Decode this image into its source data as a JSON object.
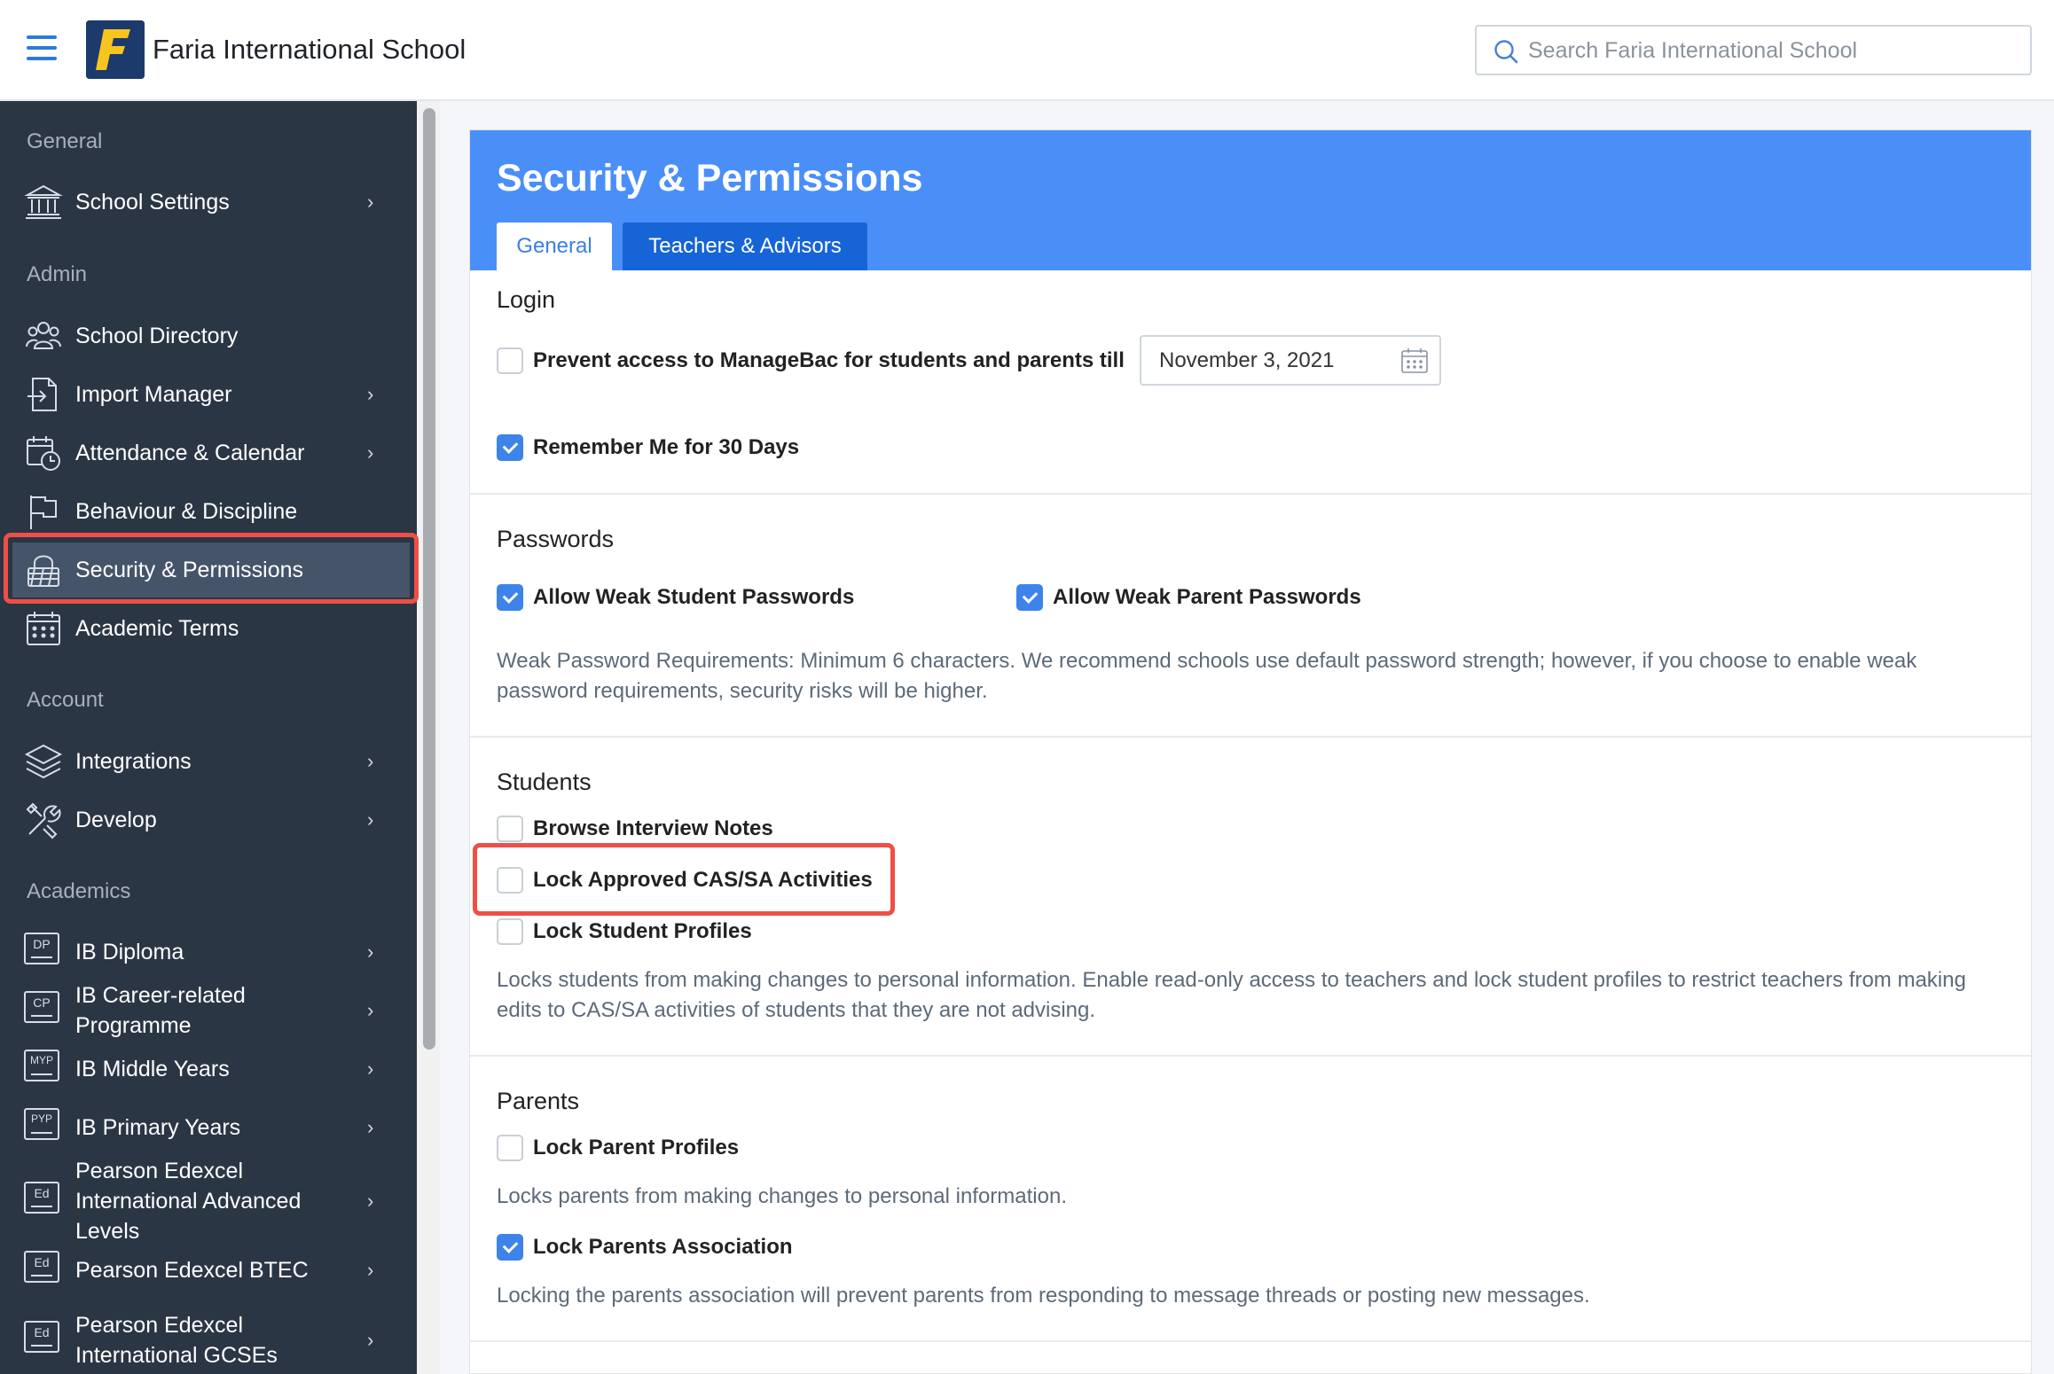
{
  "header": {
    "school_name": "Faria International School",
    "search_placeholder": "Search Faria International School"
  },
  "sidebar": {
    "sections": {
      "general": "General",
      "admin": "Admin",
      "account": "Account",
      "academics": "Academics"
    },
    "items": [
      {
        "label": "School Settings",
        "icon": "bank-icon"
      },
      {
        "label": "School Directory",
        "icon": "users-icon"
      },
      {
        "label": "Import Manager",
        "icon": "import-icon"
      },
      {
        "label": "Attendance & Calendar",
        "icon": "calendar-clock-icon"
      },
      {
        "label": "Behaviour & Discipline",
        "icon": "flag-icon"
      },
      {
        "label": "Security & Permissions",
        "icon": "lock-icon"
      },
      {
        "label": "Academic Terms",
        "icon": "calendar-icon"
      },
      {
        "label": "Integrations",
        "icon": "layers-icon"
      },
      {
        "label": "Develop",
        "icon": "tools-icon"
      },
      {
        "label": "IB Diploma",
        "icon": "dp-badge-icon",
        "badge": "DP"
      },
      {
        "label": "IB Career-related Programme",
        "icon": "cp-badge-icon",
        "badge": "CP"
      },
      {
        "label": "IB Middle Years",
        "icon": "myp-badge-icon",
        "badge": "MYP"
      },
      {
        "label": "IB Primary Years",
        "icon": "pyp-badge-icon",
        "badge": "PYP"
      },
      {
        "label": "Pearson Edexcel International Advanced Levels",
        "icon": "ed-badge-icon",
        "badge": "Ed"
      },
      {
        "label": "Pearson Edexcel BTEC",
        "icon": "ed-badge-icon",
        "badge": "Ed"
      },
      {
        "label": "Pearson Edexcel International GCSEs",
        "icon": "ed-badge-icon",
        "badge": "Ed"
      }
    ],
    "active_item": "Security & Permissions"
  },
  "page": {
    "title": "Security & Permissions",
    "tabs": [
      "General",
      "Teachers & Advisors"
    ],
    "active_tab": "General"
  },
  "login": {
    "title": "Login",
    "prevent_access_label": "Prevent access to ManageBac for students and parents till",
    "prevent_access_checked": false,
    "prevent_access_date": "November 3, 2021",
    "remember_me_label": "Remember Me for 30 Days",
    "remember_me_checked": true
  },
  "passwords": {
    "title": "Passwords",
    "weak_student_label": "Allow Weak Student Passwords",
    "weak_student_checked": true,
    "weak_parent_label": "Allow Weak Parent Passwords",
    "weak_parent_checked": true,
    "help": "Weak Password Requirements: Minimum 6 characters. We recommend schools use default password strength; however, if you choose to enable weak password requirements, security risks will be higher."
  },
  "students": {
    "title": "Students",
    "browse_notes_label": "Browse Interview Notes",
    "browse_notes_checked": false,
    "lock_cas_label": "Lock Approved CAS/SA Activities",
    "lock_cas_checked": false,
    "lock_profiles_label": "Lock Student Profiles",
    "lock_profiles_checked": false,
    "help": "Locks students from making changes to personal information. Enable read-only access to teachers and lock student profiles to restrict teachers from making edits to CAS/SA activities of students that they are not advising."
  },
  "parents": {
    "title": "Parents",
    "lock_profiles_label": "Lock Parent Profiles",
    "lock_profiles_checked": false,
    "lock_profiles_help": "Locks parents from making changes to personal information.",
    "lock_association_label": "Lock Parents Association",
    "lock_association_checked": true,
    "lock_association_help": "Locking the parents association will prevent parents from responding to message threads or posting new messages."
  },
  "colors": {
    "accent": "#4a8ff8",
    "sidebar_bg": "#2b3645",
    "highlight": "#ef4f46",
    "checkbox_on": "#3d83ea"
  }
}
